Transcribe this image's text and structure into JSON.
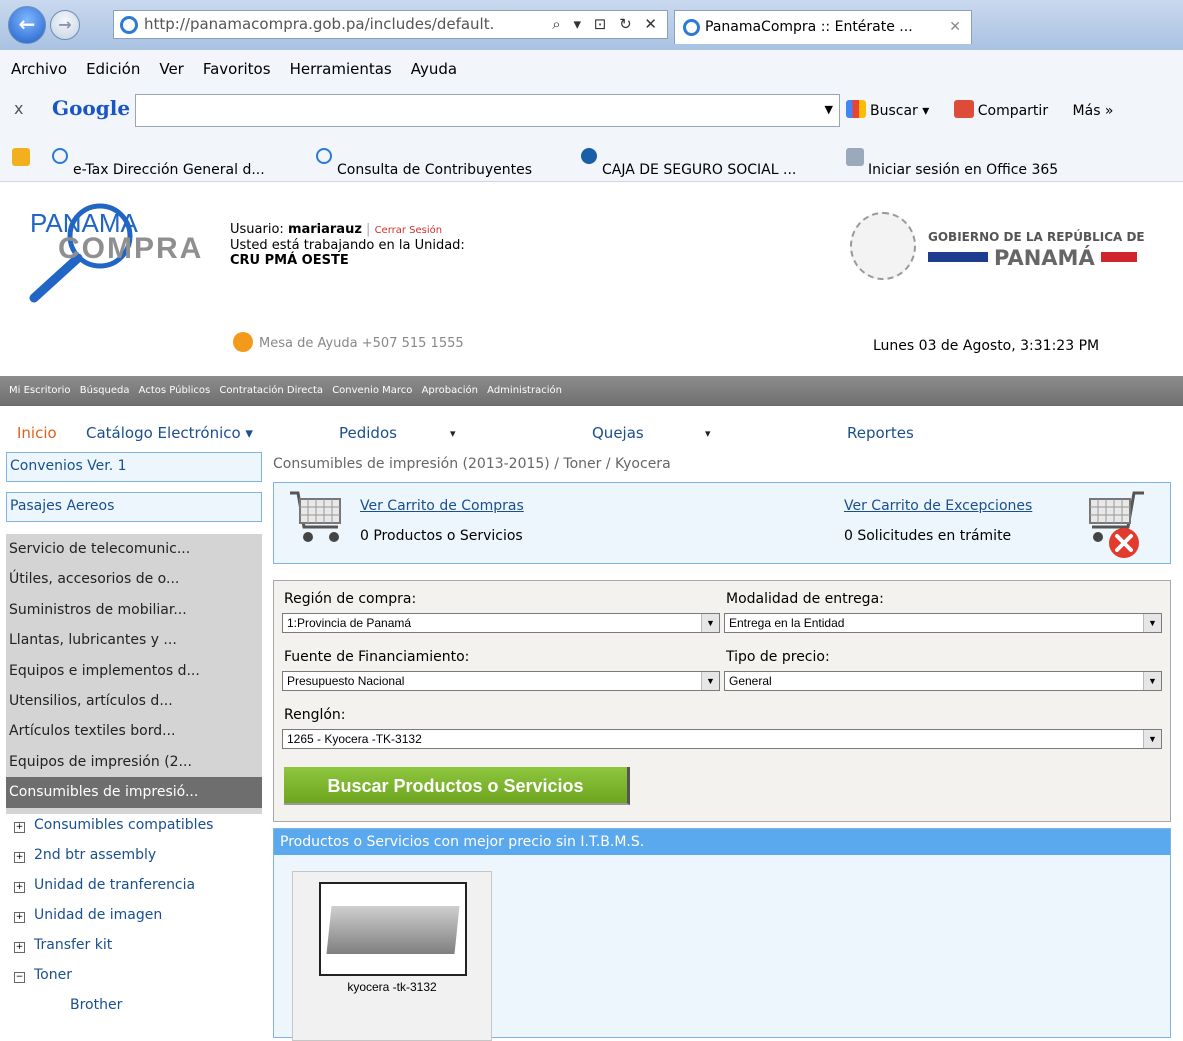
{
  "browser": {
    "url_host": "http://panamacompra.gob.pa",
    "url_path": "/includes/default.",
    "url_controls": "⌕ ▾ ⊡ ↻ ✕",
    "tab_title": "PanamaCompra :: Entérate ...",
    "tab_close": "✕",
    "back": "←",
    "forward": "→"
  },
  "menu": [
    "Archivo",
    "Edición",
    "Ver",
    "Favoritos",
    "Herramientas",
    "Ayuda"
  ],
  "google_bar": {
    "close": "x",
    "logo": "Google",
    "buscar": "Buscar ▾",
    "compartir": "Compartir",
    "mas": "Más »",
    "dropdown": "▼"
  },
  "favorites": [
    "e-Tax  Dirección General d...",
    "Consulta de Contribuyentes",
    "CAJA DE SEGURO SOCIAL ...",
    "Iniciar sesión en Office 365"
  ],
  "header": {
    "logo_top": "PANAMA",
    "logo_bottom": "COMPRA",
    "usuario_label": "Usuario:",
    "usuario": "mariarauz",
    "cerrar": "Cerrar Sesión",
    "unidad_label": "Usted está trabajando en la Unidad:",
    "unidad": "CRU PMÁ OESTE",
    "gov_line1": "GOBIERNO DE LA REPÚBLICA DE",
    "gov_line2": "PANAMÁ",
    "help": "Mesa de Ayuda +507 515 1555",
    "date": "Lunes 03 de Agosto, 3:31:23 PM"
  },
  "main_nav": [
    "Mi Escritorio",
    "Búsqueda",
    "Actos Públicos",
    "Contratación Directa",
    "Convenio Marco",
    "Aprobación",
    "Administración"
  ],
  "sub_nav": {
    "inicio": "Inicio",
    "catalogo": "Catálogo Electrónico ▾",
    "pedidos": "Pedidos",
    "quejas": "Quejas",
    "reportes": "Reportes",
    "arrow": "▾"
  },
  "sidebar": {
    "boxes": [
      "Convenios Ver. 1",
      "Pasajes Aereos"
    ],
    "groups": [
      "Servicio de telecomunic...",
      "Útiles, accesorios de o...",
      "Suministros de mobiliar...",
      "Llantas, lubricantes y ...",
      "Equipos e implementos d...",
      "Utensilios, artículos d...",
      "Artículos textiles bord...",
      "Equipos de impresión (2...",
      "Consumibles de impresió..."
    ],
    "tree": [
      {
        "sign": "+",
        "label": "Consumibles compatibles"
      },
      {
        "sign": "+",
        "label": "2nd btr assembly"
      },
      {
        "sign": "+",
        "label": "Unidad de tranferencia"
      },
      {
        "sign": "+",
        "label": "Unidad de imagen"
      },
      {
        "sign": "+",
        "label": "Transfer kit"
      },
      {
        "sign": "−",
        "label": "Toner"
      }
    ],
    "tree_child": "Brother"
  },
  "breadcrumb": "Consumibles de impresión (2013-2015) / Toner / Kyocera",
  "cart": {
    "link1": "Ver Carrito de Compras",
    "text1": "0 Productos o Servicios",
    "link2": "Ver Carrito de Excepciones",
    "text2": "0 Solicitudes en trámite"
  },
  "form": {
    "region_label": "Región de compra:",
    "region_value": "1:Provincia de Panamá",
    "modalidad_label": "Modalidad de entrega:",
    "modalidad_value": "Entrega en la Entidad",
    "fuente_label": "Fuente de Financiamiento:",
    "fuente_value": "Presupuesto Nacional",
    "tipo_label": "Tipo de precio:",
    "tipo_value": "General",
    "renglon_label": "Renglón:",
    "renglon_value": "1265 - Kyocera -TK-3132",
    "buscar": "Buscar Productos o Servicios",
    "arrow": "▼"
  },
  "results": {
    "header": "Productos o Servicios con mejor precio sin I.T.B.M.S.",
    "product_name": "kyocera -tk-3132"
  },
  "colors": {
    "accent_blue": "#5aa9ee",
    "link_blue": "#1a4f8f",
    "button_green": "#7cb52c",
    "inicio_orange": "#e0601a"
  }
}
